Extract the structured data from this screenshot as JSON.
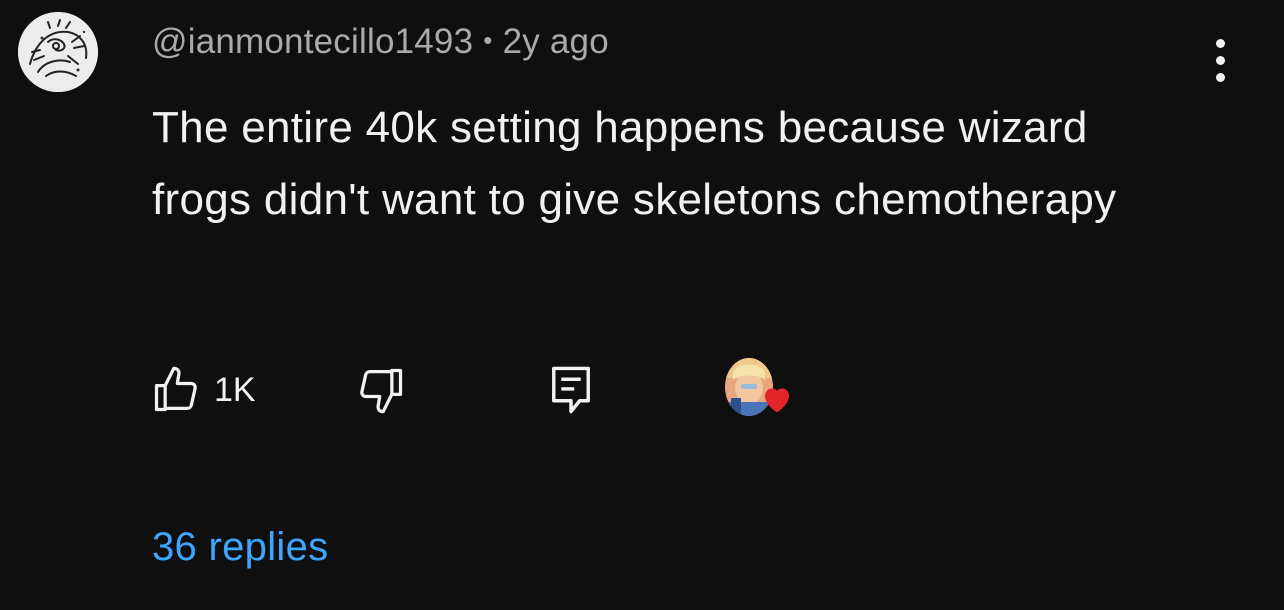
{
  "comment": {
    "author": "@ianmontecillo1493",
    "separator": "•",
    "time": "2y ago",
    "text": "The entire 40k setting happens because wizard frogs didn't want to give skeletons chemotherapy",
    "like_count": "1K",
    "replies_label": "36 replies"
  },
  "icons": {
    "avatar": "avatar-sketch-icon",
    "menu": "more-vertical-icon",
    "like": "thumbs-up-icon",
    "dislike": "thumbs-down-icon",
    "reply": "reply-comment-icon",
    "creator_heart": "heart-icon"
  },
  "colors": {
    "background": "#0f0f0f",
    "text": "#f1f1f1",
    "secondary_text": "#aaaaaa",
    "link": "#3ea6ff",
    "heart": "#e3242b"
  }
}
